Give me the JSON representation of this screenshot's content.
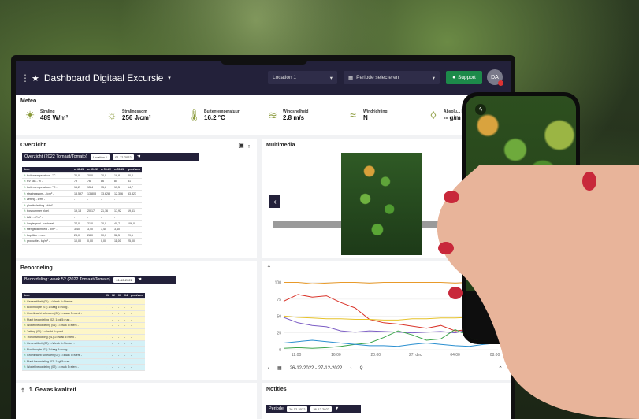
{
  "header": {
    "title": "Dashboard Digitaal Excursie",
    "location": "Location 1",
    "period_placeholder": "Periode selecteren",
    "support_label": "Support",
    "avatar_initials": "DA"
  },
  "meteo": {
    "title": "Meteo",
    "items": [
      {
        "label": "Straling",
        "value": "489 W/m²",
        "icon": "sun-icon"
      },
      {
        "label": "Stralingssom",
        "value": "256 J/cm²",
        "icon": "sun-sum-icon"
      },
      {
        "label": "Buitentemperatuur",
        "value": "16.2 °C",
        "icon": "thermometer-icon"
      },
      {
        "label": "Windsnelheid",
        "value": "2.8 m/s",
        "icon": "wind-icon"
      },
      {
        "label": "Windrichting",
        "value": "N",
        "icon": "wind-direction-icon"
      },
      {
        "label": "Absolu... buitenl...",
        "value": "-- g/m",
        "icon": "drop-icon"
      }
    ]
  },
  "overzicht": {
    "title": "Overzicht",
    "bar_label": "Overzicht (2022 Tomaat/Tomato)",
    "location": "Location 1",
    "date": "01-12-2022",
    "columns": [
      "Item",
      "w 48-22",
      "w 49-22",
      "w 50-22",
      "w 51-22",
      "gem/som"
    ],
    "rows": [
      [
        "buitentemperatuur - °C -",
        "20,0",
        "20,0",
        "20,0",
        "19,8",
        "20,0"
      ],
      [
        "RV kas - % -",
        "79",
        "76",
        "86",
        "85",
        "81"
      ],
      [
        "buitentemperatuur - °C -",
        "16,2",
        "15,4",
        "15,6",
        "13,5",
        "14,7"
      ],
      [
        "stralingssom - J/cm² -",
        "13.597",
        "13.808",
        "13.628",
        "12.306",
        "53.823"
      ],
      [
        "zetting - #/m² -",
        "-",
        "-",
        "-",
        "-",
        "-"
      ],
      [
        "plantbelasting - #/m² -",
        "-",
        "-",
        "-",
        "-",
        "-"
      ],
      [
        "trosnummer bloei -",
        "19,18",
        "20,17",
        "21,16",
        "17,92",
        "19,61"
      ],
      [
        "LAI - m²/m² -",
        "-",
        "-",
        "-",
        "-",
        "-"
      ],
      [
        "lengtegroei - cm/week -",
        "27,0",
        "21,0",
        "20,0",
        "40,7",
        "106,0"
      ],
      [
        "stengeldichtheid - #/m² -",
        "3,40",
        "3,40",
        "3,40",
        "3,40",
        "-"
      ],
      [
        "kopdikte - mm -",
        "28,0",
        "28,0",
        "30,0",
        "32,5",
        "29,1"
      ],
      [
        "productie - kg/m² -",
        "10,00",
        "0,00",
        "0,00",
        "11,00",
        "25,00"
      ]
    ]
  },
  "multimedia": {
    "title": "Multimedia"
  },
  "beoordeling": {
    "title": "Beoordeling",
    "bar_label": "Beoordeling: week 52 (2022 Tomaat/Tomato)",
    "date": "01-12-2022",
    "columns": [
      "Item",
      "01",
      "02",
      "03",
      "04",
      "gem/som"
    ],
    "rows": [
      [
        "Generatiliteit (01) 1=Week 5=Sterker -",
        "-",
        "-",
        "-",
        "-",
        "-"
      ],
      [
        "Bloeihoogte (01) 1=laag 5=hoog -",
        "-",
        "-",
        "-",
        "-",
        "-"
      ],
      [
        "Groeikracht scheuten (02) 1=zwak 5=sterk -",
        "-",
        "-",
        "-",
        "-",
        "-"
      ],
      [
        "Plant beoordeling (02) 1=gl 5=rust -",
        "-",
        "-",
        "-",
        "-",
        "-"
      ],
      [
        "Wortel beoordeling (01) 1=zwak 5=sterk -",
        "-",
        "-",
        "-",
        "-",
        "-"
      ],
      [
        "Zetting (01) 1=slecht 5=goed -",
        "-",
        "-",
        "-",
        "-",
        "-"
      ],
      [
        "Trosontwikkeling (01) 1=zwak 5=sterk -",
        "-",
        "-",
        "-",
        "-",
        "-"
      ],
      [
        "Generatiliteit (02) 1=Week 5=Sterker -",
        "-",
        "-",
        "-",
        "-",
        "-"
      ],
      [
        "Bloeihoogte (02) 1=laag 5=hoog -",
        "-",
        "-",
        "-",
        "-",
        "-"
      ],
      [
        "Groeikracht scheuten (02) 1=zwak 5=sterk -",
        "-",
        "-",
        "-",
        "-",
        "-"
      ],
      [
        "Plant beoordeling (02) 1=gl 5=rust -",
        "-",
        "-",
        "-",
        "-",
        "-"
      ],
      [
        "Wortel beoordeling (02) 1=zwak 5=sterk -",
        "-",
        "-",
        "-",
        "-",
        "-"
      ]
    ]
  },
  "gewas": {
    "title": "1. Gewas kwaliteit"
  },
  "notities": {
    "title": "Notities",
    "periode_label": "Periode",
    "from": "26-12-2022",
    "to": "26-12-2022"
  },
  "chart_nav": {
    "range": "26-12-2022 - 27-12-2022"
  },
  "chart_data": {
    "type": "line",
    "x": [
      "12:00",
      "16:00",
      "20:00",
      "27. dec",
      "04:00",
      "08:00"
    ],
    "yticks": [
      0,
      25,
      50,
      75,
      100
    ],
    "ylim": [
      0,
      110
    ],
    "series": [
      {
        "color": "#e89a2a",
        "values": [
          100,
          100,
          98,
          99,
          100,
          100,
          99,
          100,
          100,
          100,
          100,
          100,
          99,
          100,
          100,
          100
        ]
      },
      {
        "color": "#d9342a",
        "values": [
          72,
          82,
          78,
          80,
          70,
          62,
          45,
          40,
          38,
          35,
          32,
          36,
          28,
          30,
          40,
          38
        ]
      },
      {
        "color": "#7b5cc4",
        "values": [
          48,
          40,
          36,
          34,
          28,
          26,
          28,
          27,
          26,
          25,
          26,
          27,
          25,
          30,
          28,
          34
        ]
      },
      {
        "color": "#e6c22a",
        "values": [
          50,
          48,
          47,
          46,
          46,
          45,
          45,
          44,
          44,
          46,
          46,
          47,
          47,
          48,
          48,
          49
        ]
      },
      {
        "color": "#3aa44a",
        "values": [
          2,
          3,
          2,
          3,
          5,
          8,
          10,
          18,
          28,
          22,
          14,
          16,
          30,
          20,
          14,
          25
        ]
      },
      {
        "color": "#2a8fd0",
        "values": [
          10,
          12,
          14,
          12,
          10,
          8,
          6,
          6,
          5,
          8,
          10,
          8,
          6,
          5,
          8,
          10
        ]
      }
    ]
  }
}
